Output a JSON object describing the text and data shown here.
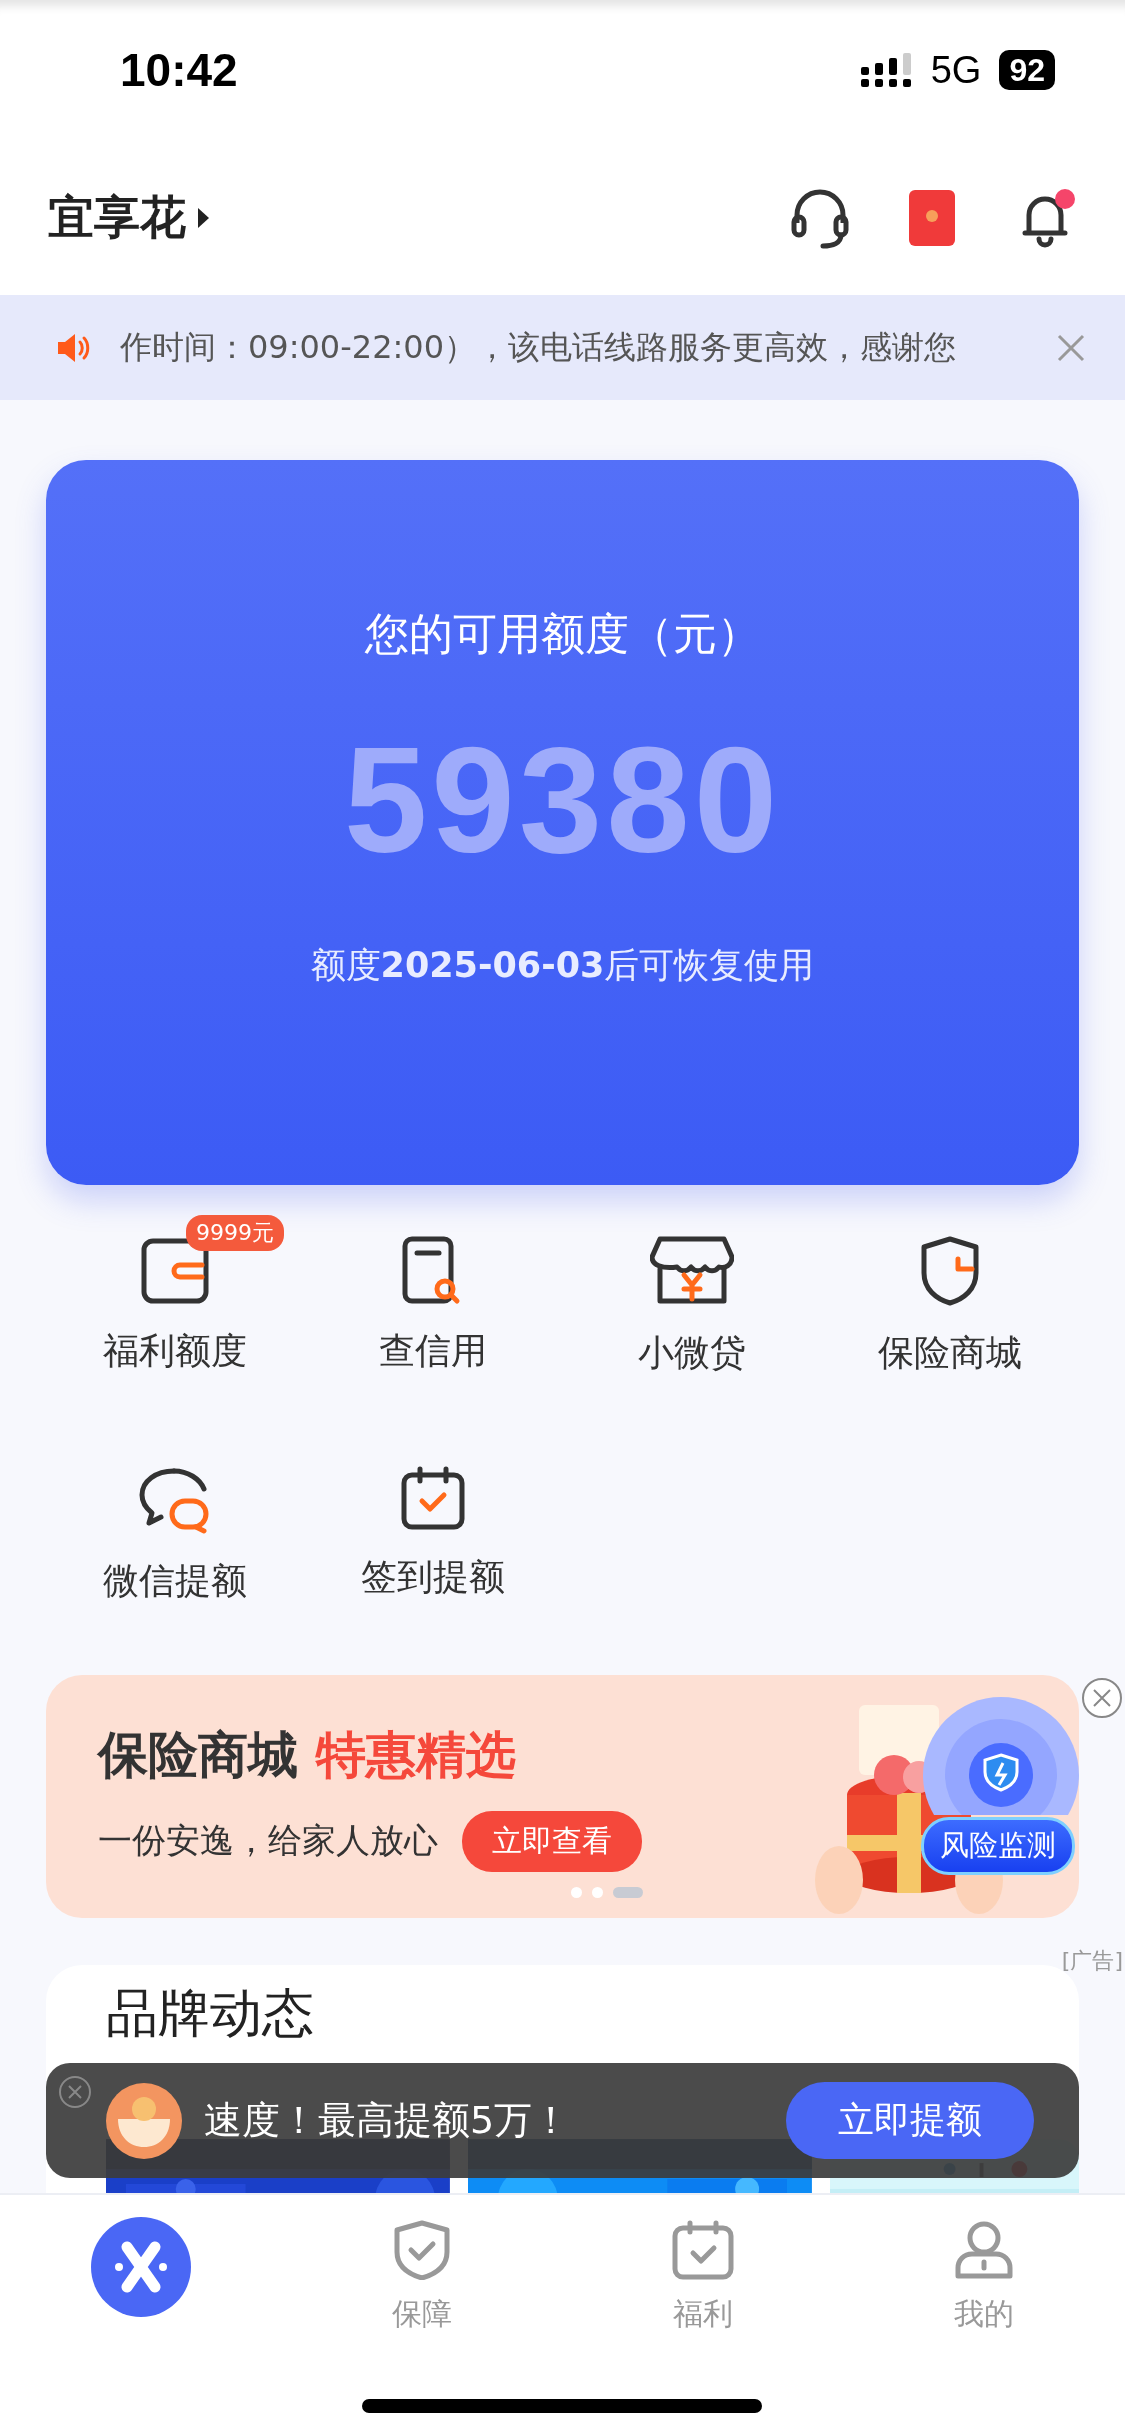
{
  "status_bar": {
    "time": "10:42",
    "network": "5G",
    "battery": "92"
  },
  "header": {
    "title": "宜享花",
    "notification_dot": true
  },
  "notice": {
    "text": "作时间：09:00-22:00），该电话线路服务更高效，感谢您"
  },
  "credit_card": {
    "label": "您的可用额度（元）",
    "amount": "59380",
    "note": "额度**2025-06-03**后可恢复使用"
  },
  "shortcuts": [
    {
      "kind": "wallet",
      "label": "福利额度",
      "badge": "9999元"
    },
    {
      "kind": "report",
      "label": "查信用"
    },
    {
      "kind": "shop",
      "label": "小微贷"
    },
    {
      "kind": "shield",
      "label": "保险商城"
    },
    {
      "kind": "chat",
      "label": "微信提额"
    },
    {
      "kind": "calendar",
      "label": "签到提额"
    }
  ],
  "banner": {
    "title": "保险商城",
    "highlight": "特惠精选",
    "subtitle": "一份安逸，给家人放心",
    "button": "立即查看",
    "dots": [
      {
        "selected": false
      },
      {
        "selected": false
      },
      {
        "selected": true
      }
    ],
    "kind": "picture"
  },
  "floating_widget": {
    "label": "风险监测",
    "ad_tag": "[广告]"
  },
  "brand_section": {
    "title": "品牌动态"
  },
  "toast": {
    "text": "速度！最高提额5万！",
    "button": "立即提额"
  },
  "tabs": [
    {
      "kind": "logo",
      "selected": true
    },
    {
      "kind": "shield",
      "label": "保障",
      "selected": false
    },
    {
      "kind": "calendar",
      "label": "福利",
      "selected": false
    },
    {
      "kind": "person",
      "label": "我的",
      "selected": false
    }
  ]
}
